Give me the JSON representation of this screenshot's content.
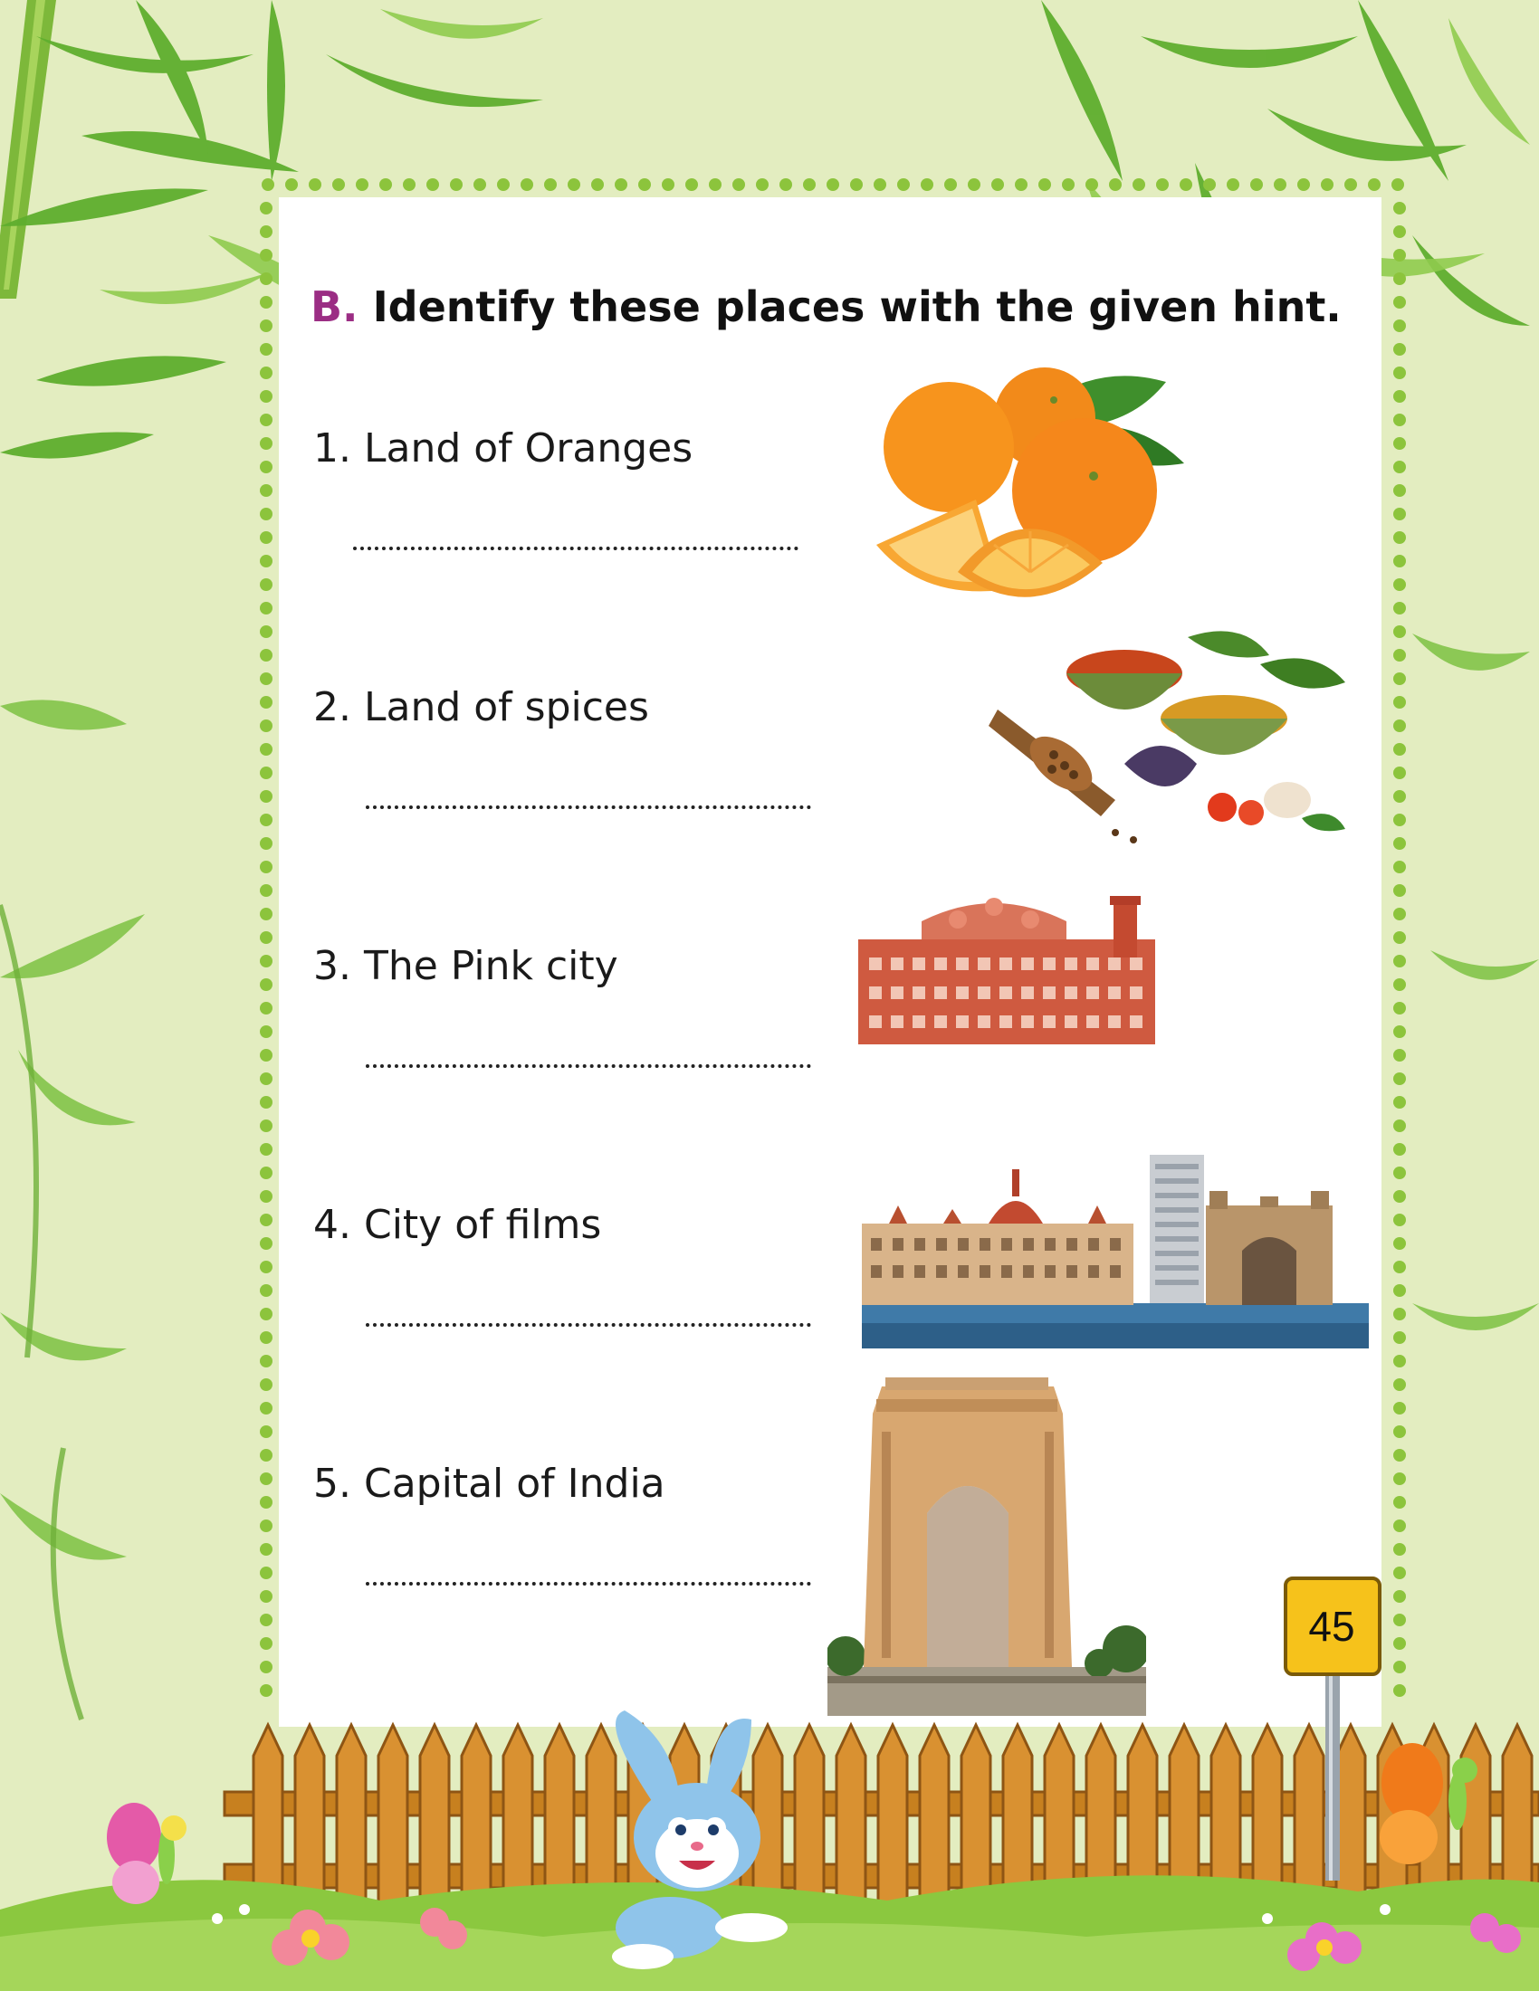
{
  "exercise": {
    "label": "B.",
    "instruction": "Identify these places with the given hint."
  },
  "questions": [
    {
      "number": "1.",
      "hint": "Land of Oranges",
      "image": "oranges-image"
    },
    {
      "number": "2.",
      "hint": "Land of spices",
      "image": "spices-image"
    },
    {
      "number": "3.",
      "hint": "The Pink city",
      "image": "hawa-mahal-image"
    },
    {
      "number": "4.",
      "hint": "City of films",
      "image": "mumbai-skyline-image"
    },
    {
      "number": "5.",
      "hint": "Capital of India",
      "image": "india-gate-image"
    }
  ],
  "page_number": "45",
  "colors": {
    "background": "#e3edc0",
    "accent_label": "#9b2d84",
    "border_dots": "#8cc43c",
    "sign": "#f6c21b"
  }
}
